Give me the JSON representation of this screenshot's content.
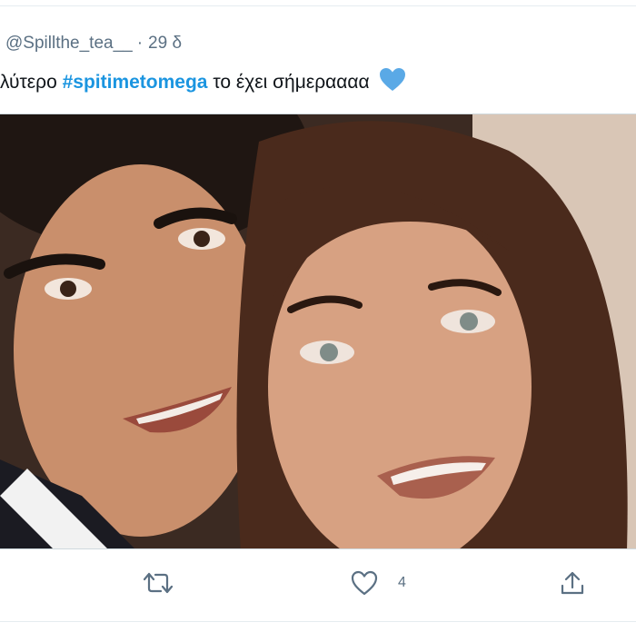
{
  "tweet": {
    "handle": "@Spillthe_tea__",
    "separator": "·",
    "time": "29 δ",
    "text_before": "λύτερο ",
    "hashtag": "#spitimetomega",
    "text_after": " το έχει σήμεραααα",
    "emoji": "blue-heart-icon"
  },
  "media": {
    "description_icon": "photo"
  },
  "actions": {
    "retweet_icon": "retweet-icon",
    "like_icon": "heart-outline-icon",
    "like_count": "4",
    "share_icon": "share-icon"
  },
  "colors": {
    "hashtag": "#1b95e0",
    "secondary_text": "#5b7083",
    "heart": "#5aa9e6"
  }
}
